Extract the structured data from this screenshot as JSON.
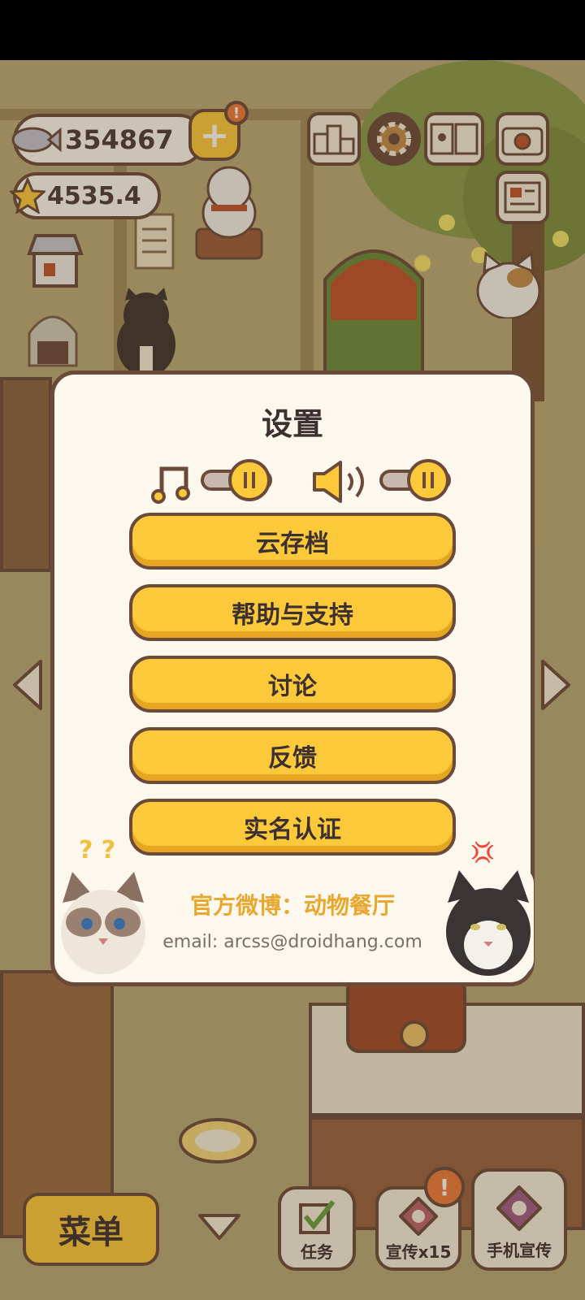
{
  "hud": {
    "fish_count": "354867",
    "star_count": "4535.4",
    "add_badge": "!",
    "leaderboard_icon": "leaderboard-icon",
    "settings_icon": "gear-icon",
    "book_icon": "book-icon",
    "camera_icon": "camera-icon",
    "news_icon": "newspaper-icon"
  },
  "settings": {
    "title": "设置",
    "music_icon": "music-note-icon",
    "sound_icon": "speaker-icon",
    "buttons": [
      {
        "label": "云存档"
      },
      {
        "label": "帮助与支持"
      },
      {
        "label": "讨论"
      },
      {
        "label": "反馈"
      },
      {
        "label": "实名认证"
      }
    ],
    "weibo": "官方微博：动物餐厅",
    "email": "email: arcss@droidhang.com",
    "cat_left_marks": "? ?",
    "cat_right_mark": "💢"
  },
  "bottom_bar": {
    "menu_label": "菜单",
    "task_label": "任务",
    "promo_label": "宣传x15",
    "phone_promo_label": "手机宣传",
    "promo_badge": "!"
  },
  "colors": {
    "accent": "#fcc93a",
    "outline": "#6b4a3a",
    "panel": "#fdf8ee",
    "badge": "#f07a3a"
  }
}
